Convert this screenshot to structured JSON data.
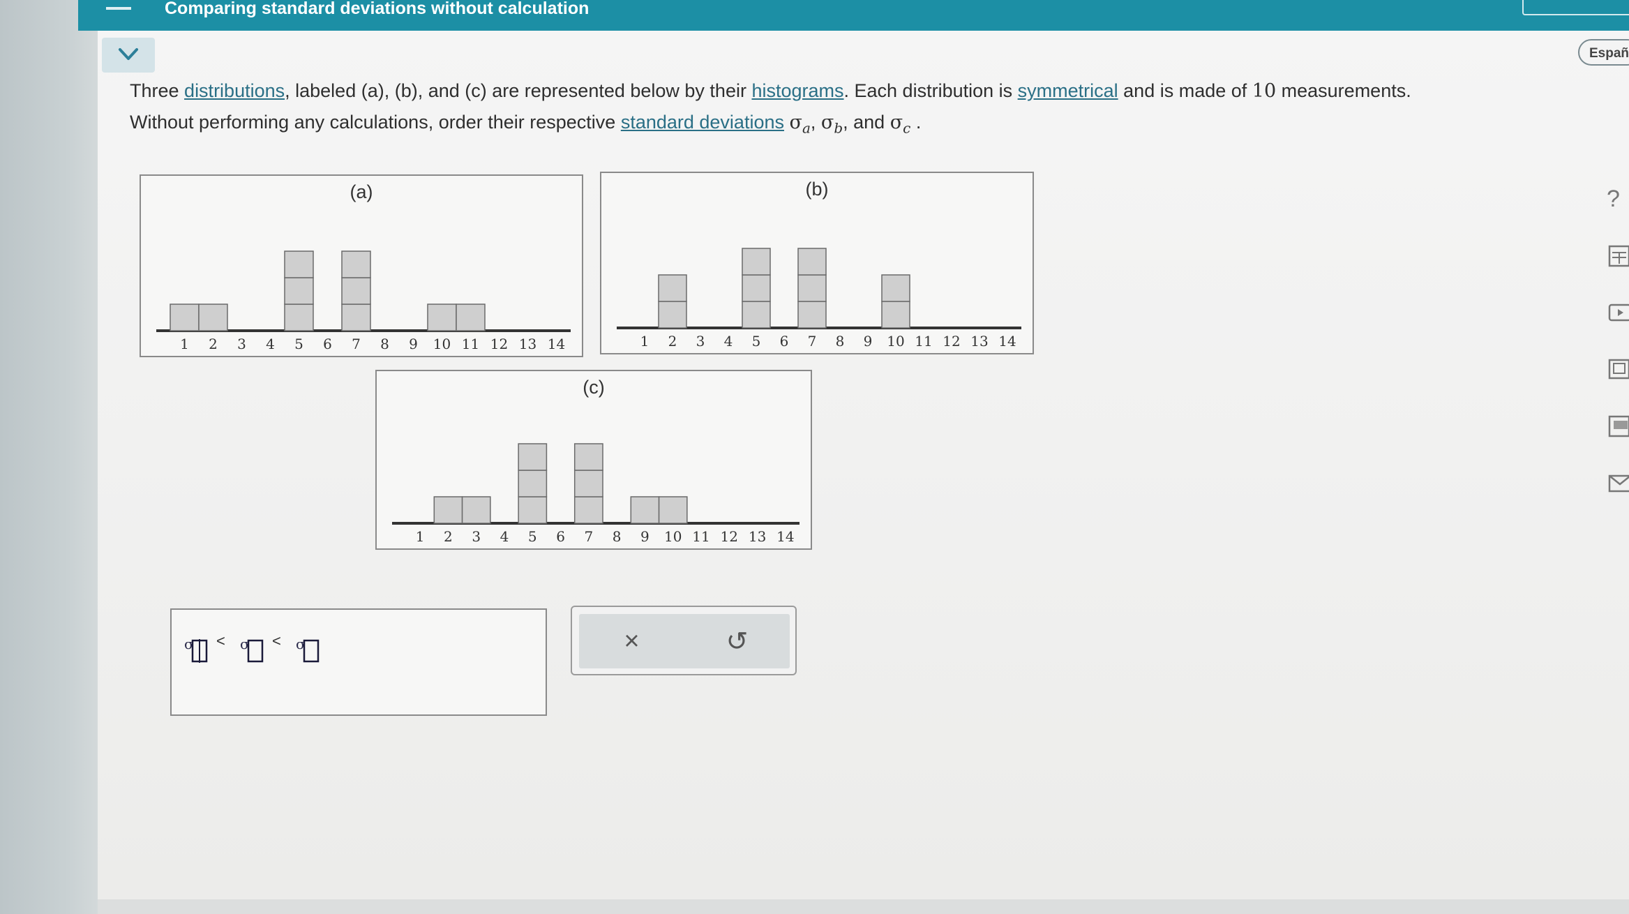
{
  "header": {
    "title": "Comparing standard deviations without calculation",
    "language_button": "Españo"
  },
  "problem": {
    "line1_part1": "Three ",
    "link_distributions": "distributions",
    "line1_part2": ", labeled (a), (b), and (c) are represented below by their ",
    "link_histograms": "histograms",
    "line1_part3": ". Each distribution is ",
    "link_symmetrical": "symmetrical",
    "line1_part4": " and is made of ",
    "count": "10",
    "line1_part5": " measurements.",
    "line2_part1": "Without performing any calculations, order their respective ",
    "link_standard_deviations": "standard deviations",
    "sigma": "σ",
    "sub_a": "a",
    "sub_b": "b",
    "sub_c": "c",
    "sep1": ", ",
    "sep2": ", and ",
    "end": " ."
  },
  "chart_data": [
    {
      "type": "bar",
      "title": "(a)",
      "categories": [
        "1",
        "2",
        "3",
        "4",
        "5",
        "6",
        "7",
        "8",
        "9",
        "10",
        "11",
        "12",
        "13",
        "14"
      ],
      "values": [
        1,
        1,
        0,
        0,
        3,
        0,
        3,
        0,
        0,
        1,
        1,
        0,
        0,
        0
      ]
    },
    {
      "type": "bar",
      "title": "(b)",
      "categories": [
        "1",
        "2",
        "3",
        "4",
        "5",
        "6",
        "7",
        "8",
        "9",
        "10",
        "11",
        "12",
        "13",
        "14"
      ],
      "values": [
        0,
        2,
        0,
        0,
        3,
        0,
        3,
        0,
        0,
        2,
        0,
        0,
        0,
        0
      ]
    },
    {
      "type": "bar",
      "title": "(c)",
      "categories": [
        "1",
        "2",
        "3",
        "4",
        "5",
        "6",
        "7",
        "8",
        "9",
        "10",
        "11",
        "12",
        "13",
        "14"
      ],
      "values": [
        0,
        1,
        1,
        0,
        3,
        0,
        3,
        0,
        1,
        1,
        0,
        0,
        0,
        0
      ]
    }
  ],
  "answer": {
    "sigma": "σ",
    "lt": "<"
  },
  "tools": {
    "clear_symbol": "×",
    "undo_symbol": "↺"
  },
  "sidebar": {
    "help_symbol": "?"
  },
  "colors": {
    "header": "#1c8fa5",
    "link": "#2a6f86",
    "bar_fill": "#cfcfcf",
    "bar_stroke": "#6a6a6a"
  }
}
